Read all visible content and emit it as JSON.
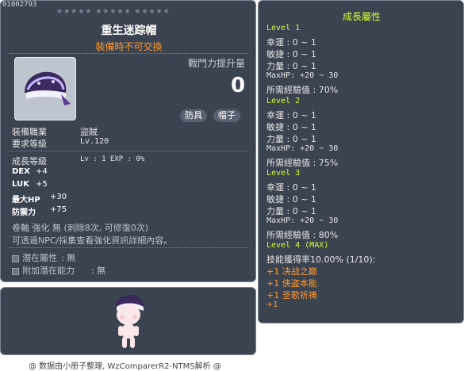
{
  "item": {
    "code": "01002793",
    "stars": "★★★★★ ★★★★★ ★★★★★",
    "name": "重生迷踪帽",
    "trade_note": "裝備時不可交換",
    "power_label": "戰鬥力提升量",
    "power_value": "0",
    "tags": [
      "防具",
      "帽子"
    ],
    "info": [
      {
        "label": "裝備職業",
        "value": "盜賊"
      },
      {
        "label": "要求等級",
        "value": "Lv.120"
      }
    ],
    "growth": {
      "label": "成長等級",
      "value": "Lv : 1  EXP : 0%"
    },
    "stats": [
      {
        "label": "DEX",
        "value": "+4"
      },
      {
        "label": "LUK",
        "value": "+5"
      },
      {
        "label": "最大HP",
        "value": "+30"
      },
      {
        "label": "防禦力",
        "value": "+75"
      }
    ],
    "scroll_line": "卷軸 強化 無 (刺除8次, 可修復0次)",
    "npc_line": "可透過NPC/採集查看強化資訊詳細內容。",
    "potentials": [
      {
        "label": "潛在屬性",
        "value": ": 無"
      },
      {
        "label": "附加潛在能力",
        "value": ": 無"
      }
    ]
  },
  "footer": "@ 数据由小册子整理, WzComparerR2-NTMS解析 @",
  "growth_panel": {
    "title": "成長屬性",
    "levels": [
      {
        "name": "Level 1",
        "luck": "幸運 : 0 ~ 1",
        "dex": "敏捷 : 0 ~ 1",
        "str": "力量 : 0 ~ 1",
        "hp": "MaxHP:  +20 ~ 30",
        "exp": "所需經驗值 : 70%"
      },
      {
        "name": "Level 2",
        "luck": "幸運 : 0 ~ 1",
        "dex": "敏捷 : 0 ~ 1",
        "str": "力量 : 0 ~ 1",
        "hp": "MaxHP:  +20 ~ 30",
        "exp": "所需經驗值 : 75%"
      },
      {
        "name": "Level 3",
        "luck": "幸運 : 0 ~ 1",
        "dex": "敏捷 : 0 ~ 1",
        "str": "力量 : 0 ~ 1",
        "hp": "MaxHP:  +20 ~ 30",
        "exp": "所需經驗值 : 80%"
      }
    ],
    "max_level": "Level 4 (MAX)",
    "skill_rate": "技能獲得率10.00% (1/10):",
    "skills": [
      "+1 决战之巅",
      "+1 侠盗本能",
      "+1 圣歌祈祷",
      "+1"
    ]
  },
  "colors": {
    "panel": "#3b4250",
    "accent_yellow": "#d8ff3a",
    "accent_orange": "#ff9a2e"
  }
}
